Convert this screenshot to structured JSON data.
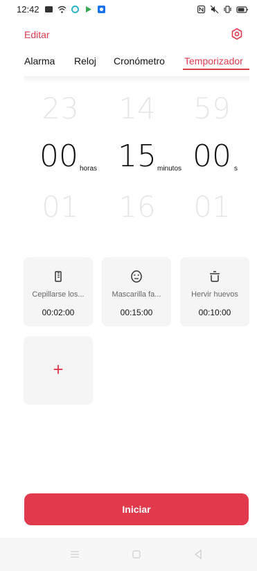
{
  "status_bar": {
    "time": "12:42"
  },
  "header": {
    "edit_label": "Editar"
  },
  "tabs": [
    {
      "label": "Alarma"
    },
    {
      "label": "Reloj"
    },
    {
      "label": "Cronómetro"
    },
    {
      "label": "Temporizador"
    }
  ],
  "picker": {
    "hours": {
      "prev": "23",
      "value": "00",
      "next": "01",
      "unit": "horas"
    },
    "minutes": {
      "prev": "14",
      "value": "15",
      "next": "16",
      "unit": "minutos"
    },
    "seconds": {
      "prev": "59",
      "value": "00",
      "next": "01",
      "unit": "s"
    }
  },
  "presets": [
    {
      "name": "Cepillarse los...",
      "time": "00:02:00",
      "icon": "toothbrush-icon"
    },
    {
      "name": "Mascarilla fa...",
      "time": "00:15:00",
      "icon": "face-mask-icon"
    },
    {
      "name": "Hervir huevos",
      "time": "00:10:00",
      "icon": "pot-icon"
    }
  ],
  "add_preset": {
    "label": "+"
  },
  "start_button": {
    "label": "Iniciar"
  },
  "colors": {
    "accent": "#e03a4e",
    "card_bg": "#f5f5f5",
    "ghost_digits": "#e7e7e7"
  }
}
